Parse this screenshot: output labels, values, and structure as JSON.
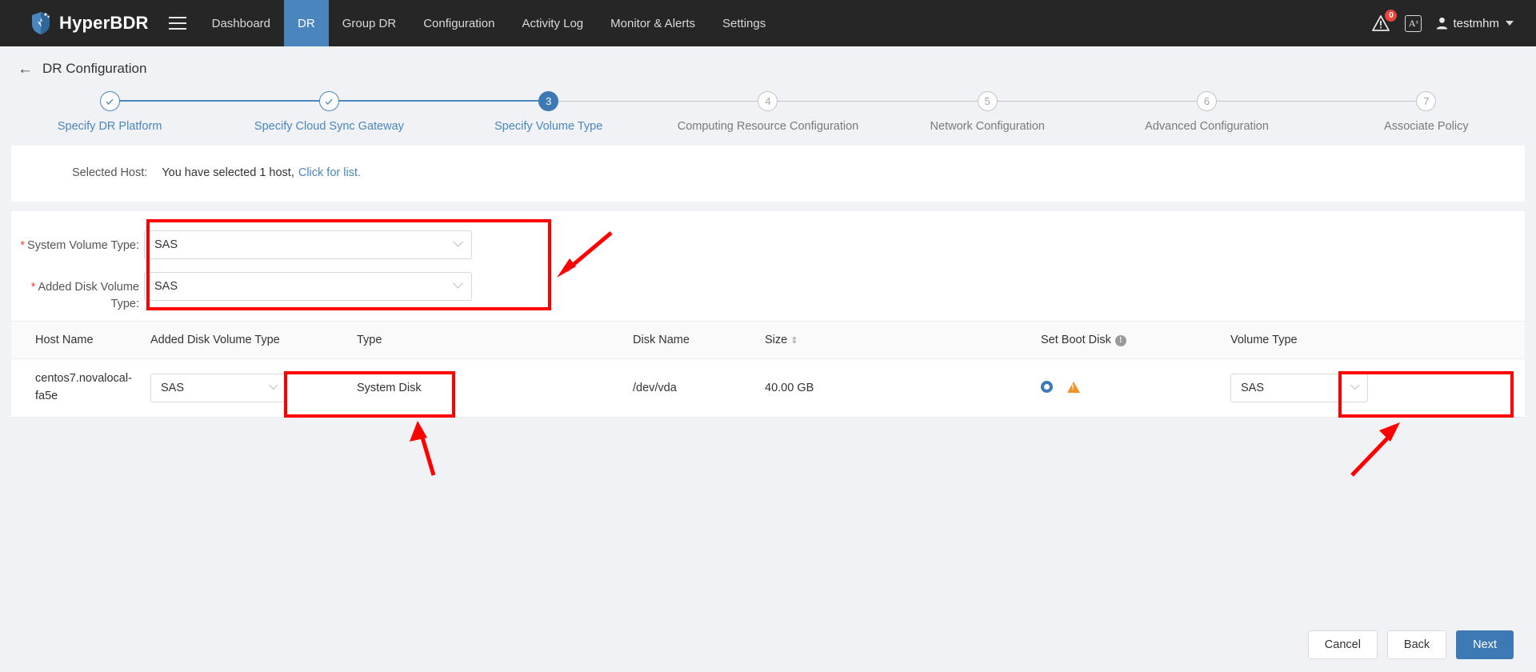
{
  "topnav": {
    "brand": "HyperBDR",
    "menu_icon": "hamburger-icon",
    "items": [
      {
        "label": "Dashboard",
        "active": false
      },
      {
        "label": "DR",
        "active": true
      },
      {
        "label": "Group DR",
        "active": false
      },
      {
        "label": "Configuration",
        "active": false
      },
      {
        "label": "Activity Log",
        "active": false
      },
      {
        "label": "Monitor & Alerts",
        "active": false
      },
      {
        "label": "Settings",
        "active": false
      }
    ],
    "alert_badge": "0",
    "lang_label": "Aˣ",
    "user": "testmhm"
  },
  "page": {
    "back_arrow": "←",
    "title": "DR Configuration"
  },
  "stepper": {
    "steps": [
      {
        "num": "1",
        "label": "Specify DR Platform",
        "state": "done"
      },
      {
        "num": "2",
        "label": "Specify Cloud Sync Gateway",
        "state": "done"
      },
      {
        "num": "3",
        "label": "Specify Volume Type",
        "state": "current"
      },
      {
        "num": "4",
        "label": "Computing Resource Configuration",
        "state": "todo"
      },
      {
        "num": "5",
        "label": "Network Configuration",
        "state": "todo"
      },
      {
        "num": "6",
        "label": "Advanced Configuration",
        "state": "todo"
      },
      {
        "num": "7",
        "label": "Associate Policy",
        "state": "todo"
      }
    ],
    "check_glyph": "✓"
  },
  "selected_host": {
    "label": "Selected Host:",
    "text_before": "You have selected 1 host,",
    "link": "Click for list."
  },
  "form": {
    "system_volume_type": {
      "label": "System Volume Type:",
      "required_mark": "*",
      "value": "SAS"
    },
    "added_disk_volume_type": {
      "label": "Added Disk Volume Type:",
      "required_mark": "*",
      "value": "SAS"
    }
  },
  "table": {
    "columns": [
      {
        "key": "host_name",
        "label": "Host Name"
      },
      {
        "key": "added_disk_volume_type",
        "label": "Added Disk Volume Type"
      },
      {
        "key": "type",
        "label": "Type"
      },
      {
        "key": "disk_name",
        "label": "Disk Name"
      },
      {
        "key": "size",
        "label": "Size",
        "sortable": true,
        "sort_glyph": "⇕"
      },
      {
        "key": "set_boot_disk",
        "label": "Set Boot Disk",
        "info": true,
        "info_glyph": "!"
      },
      {
        "key": "volume_type",
        "label": "Volume Type"
      }
    ],
    "rows": [
      {
        "host_name": "centos7.novalocal-fa5e",
        "added_disk_volume_type": "SAS",
        "type": "System Disk",
        "disk_name": "/dev/vda",
        "size": "40.00 GB",
        "set_boot_disk": "selected",
        "volume_type": "SAS"
      }
    ]
  },
  "footer": {
    "cancel": "Cancel",
    "back": "Back",
    "next": "Next"
  },
  "colors": {
    "accent": "#3d7ab5",
    "nav_bg": "#262626",
    "link": "#4a86bd",
    "annotation": "#ff0000",
    "warning": "#f0942a",
    "danger": "#e8453c"
  }
}
